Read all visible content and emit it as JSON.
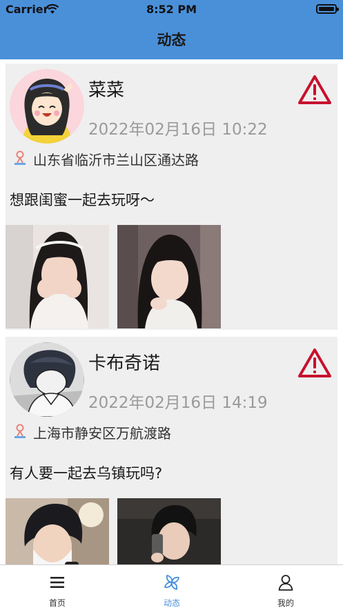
{
  "status_bar": {
    "carrier": "Carrier",
    "time": "8:52 PM"
  },
  "nav": {
    "title": "动态"
  },
  "posts": [
    {
      "name": "菜菜",
      "time": "2022年02月16日 10:22",
      "location": "山东省临沂市兰山区通达路",
      "content": "想跟闺蜜一起去玩呀～",
      "photos": [
        "girl-photo-1",
        "girl-photo-2"
      ]
    },
    {
      "name": "卡布奇诺",
      "time": "2022年02月16日 14:19",
      "location": "上海市静安区万航渡路",
      "content": "有人要一起去乌镇玩吗?",
      "photos": [
        "boy-photo-1",
        "boy-photo-2"
      ]
    }
  ],
  "tabs": [
    {
      "label": "首页",
      "icon": "menu-icon"
    },
    {
      "label": "动态",
      "icon": "pinwheel-icon",
      "active": true
    },
    {
      "label": "我的",
      "icon": "person-icon"
    }
  ],
  "colors": {
    "accent": "#4a90d9",
    "warning": "#c8102e",
    "timestamp": "#9a9a9a",
    "card": "#efefef"
  }
}
